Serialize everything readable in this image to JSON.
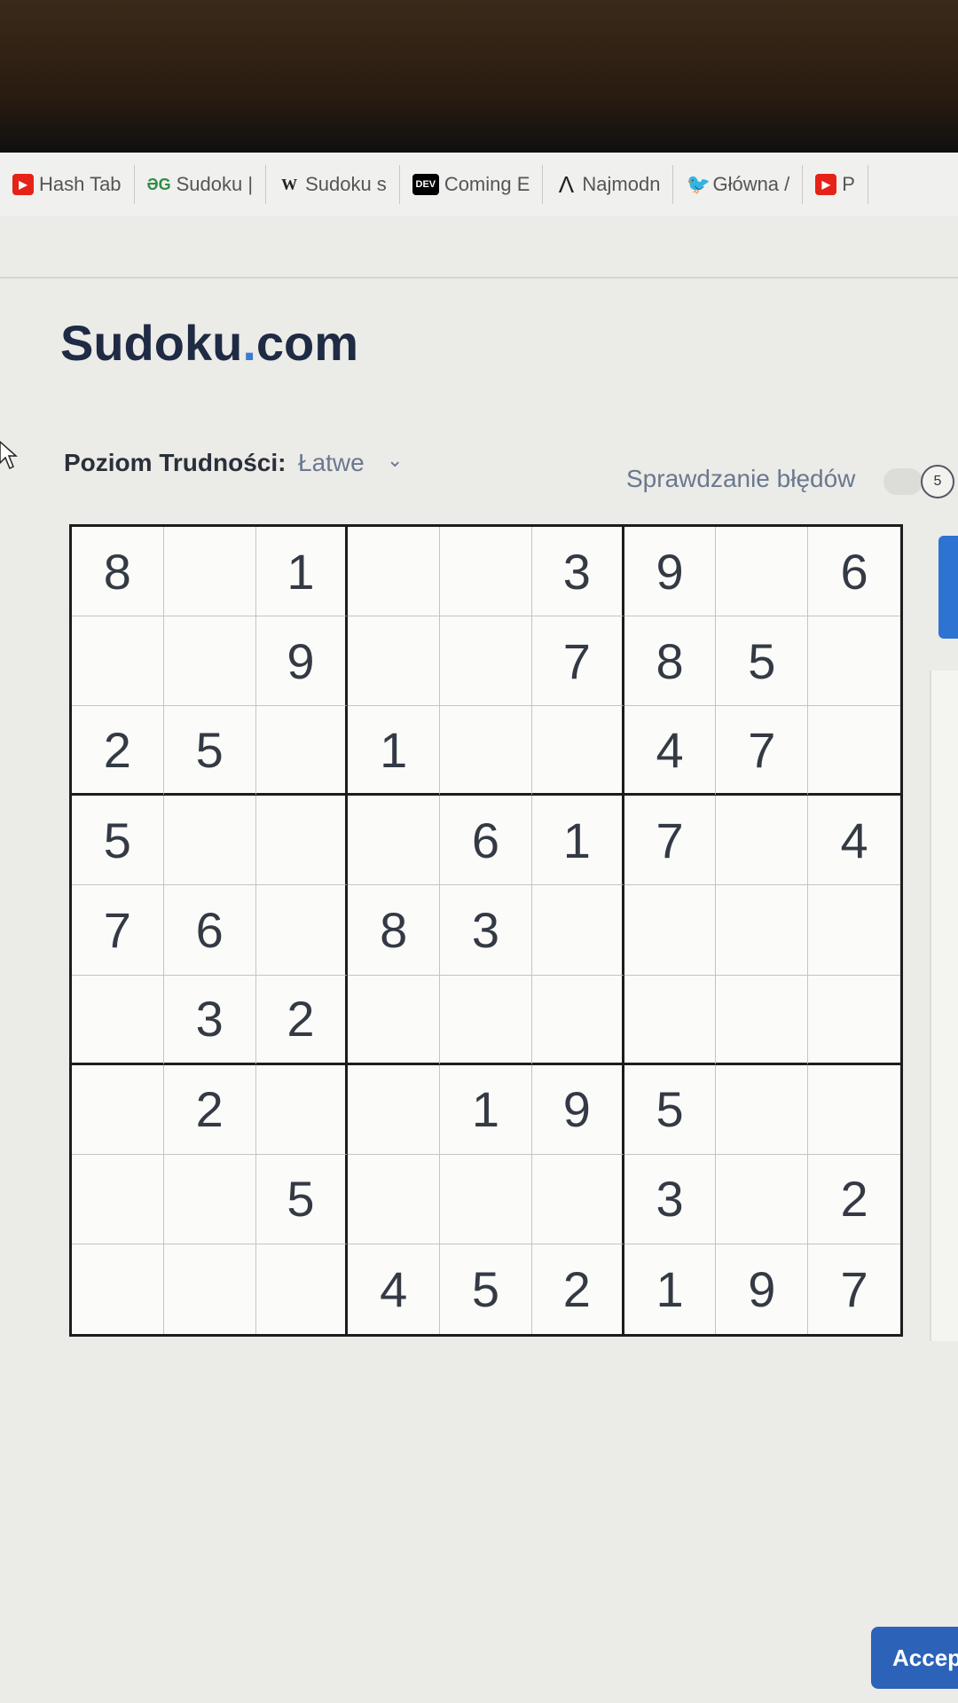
{
  "bookmarks": [
    {
      "icon": "youtube-icon",
      "glyph": "▶",
      "label": "Hash Tab"
    },
    {
      "icon": "gfg-icon",
      "glyph": "ƏG",
      "label": "Sudoku |"
    },
    {
      "icon": "wikipedia-icon",
      "glyph": "W",
      "label": "Sudoku s"
    },
    {
      "icon": "dev-icon",
      "glyph": "DEV",
      "label": "Coming E"
    },
    {
      "icon": "a-icon",
      "glyph": "Λ",
      "label": "Najmodn"
    },
    {
      "icon": "twitter-icon",
      "glyph": "🐦",
      "label": "Główna /"
    },
    {
      "icon": "youtube-icon",
      "glyph": "▶",
      "label": "P"
    }
  ],
  "site": {
    "logo_main": "Sudoku",
    "logo_dot": ".",
    "logo_tld": "com"
  },
  "controls": {
    "difficulty_label": "Poziom Trudności:",
    "difficulty_value": "Łatwe",
    "difficulty_arrow": "⌄",
    "error_check_label": "Sprawdzanie błędów",
    "badge": "5"
  },
  "board": {
    "grid": [
      [
        "8",
        "",
        "1",
        "",
        "",
        "3",
        "9",
        "",
        "6"
      ],
      [
        "",
        "",
        "9",
        "",
        "",
        "7",
        "8",
        "5",
        ""
      ],
      [
        "2",
        "5",
        "",
        "1",
        "",
        "",
        "4",
        "7",
        ""
      ],
      [
        "5",
        "",
        "",
        "",
        "6",
        "1",
        "7",
        "",
        "4"
      ],
      [
        "7",
        "6",
        "",
        "8",
        "3",
        "",
        "",
        "",
        ""
      ],
      [
        "",
        "3",
        "2",
        "",
        "",
        "",
        "",
        "",
        ""
      ],
      [
        "",
        "2",
        "",
        "",
        "1",
        "9",
        "5",
        "",
        ""
      ],
      [
        "",
        "",
        "5",
        "",
        "",
        "",
        "3",
        "",
        "2"
      ],
      [
        "",
        "",
        "",
        "4",
        "5",
        "2",
        "1",
        "9",
        "7"
      ]
    ]
  },
  "footer": {
    "accept_label": "Accept"
  },
  "colors": {
    "accent": "#2c63b8",
    "logo_dot": "#3a7bd5",
    "text": "#1f2a44"
  }
}
